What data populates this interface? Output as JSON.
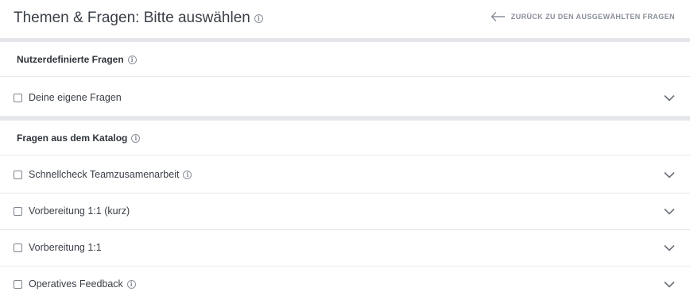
{
  "header": {
    "title": "Themen & Fragen: Bitte auswählen",
    "back_link": "ZURÜCK ZU DEN AUSGEWÄHLTEN FRAGEN"
  },
  "info_icon_glyph": "i",
  "sections": [
    {
      "title": "Nutzerdefinierte Fragen",
      "items": [
        {
          "label": "Deine eigene Fragen",
          "checked": false,
          "has_info": false
        }
      ]
    },
    {
      "title": "Fragen aus dem Katalog",
      "items": [
        {
          "label": "Schnellcheck Teamzusamenarbeit",
          "checked": false,
          "has_info": true
        },
        {
          "label": "Vorbereitung 1:1 (kurz)",
          "checked": false,
          "has_info": false
        },
        {
          "label": "Vorbereitung 1:1",
          "checked": false,
          "has_info": false
        },
        {
          "label": "Operatives Feedback",
          "checked": false,
          "has_info": true
        }
      ]
    }
  ],
  "colors": {
    "text": "#3a3f47",
    "muted": "#8a8f98",
    "divider": "#e4e6ea",
    "row_border": "#e6e8ec"
  },
  "icons": [
    "info-icon",
    "arrow-left-icon",
    "checkbox-icon",
    "chevron-down-icon"
  ]
}
